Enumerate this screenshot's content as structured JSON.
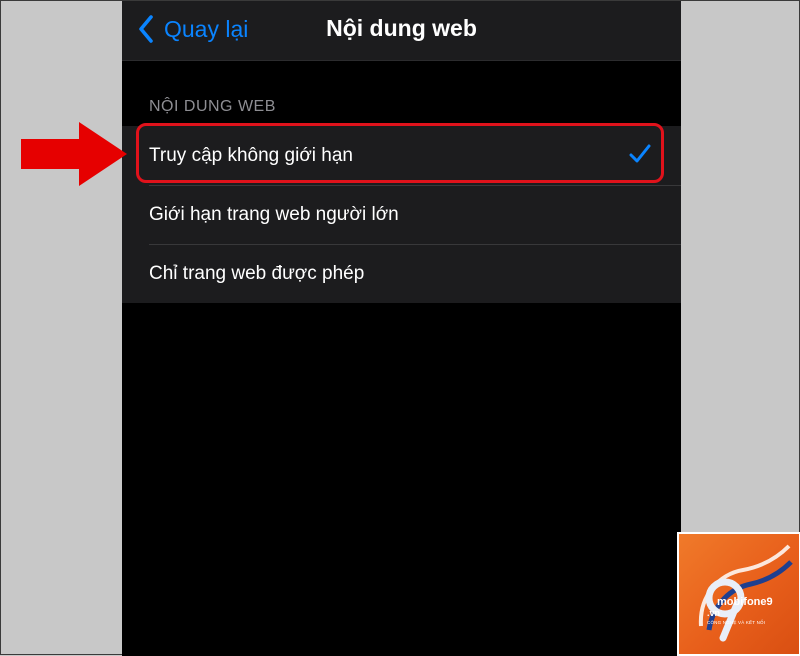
{
  "nav": {
    "back_label": "Quay lại",
    "title": "Nội dung web"
  },
  "section": {
    "header": "NỘI DUNG WEB"
  },
  "options": [
    {
      "label": "Truy cập không giới hạn",
      "selected": true
    },
    {
      "label": "Giới hạn trang web người lớn",
      "selected": false
    },
    {
      "label": "Chỉ trang web được phép",
      "selected": false
    }
  ],
  "watermark": {
    "name": "mobifone9",
    "domain": ".vn",
    "slogan": "CÔNG NGHỆ VÀ KẾT NỐI"
  },
  "colors": {
    "accent": "#0a84ff",
    "highlight": "#e0121b",
    "arrow": "#e60000",
    "logo_bg": "#e8611c"
  }
}
